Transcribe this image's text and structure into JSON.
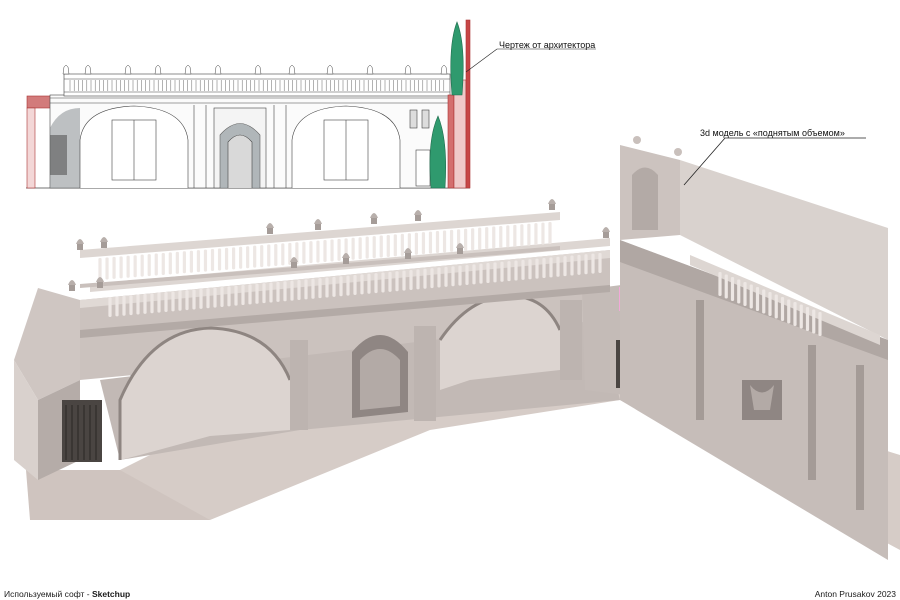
{
  "annotations": {
    "drawing_label": "Чертеж от архитектора",
    "model_label": "3d модель с «поднятым объемом»"
  },
  "footer": {
    "software_prefix": "Используемый софт - ",
    "software_name": "Sketchup",
    "author": "Anton Prusakov 2023"
  },
  "colors": {
    "background": "#ffffff",
    "model_base": "#c9c0bc",
    "model_light": "#ddd6d2",
    "model_shadow": "#8f8683",
    "ground": "#d4c9c4",
    "cast_shadow": "#3e4654",
    "window_pink": "#f2a9d8",
    "drawing_green": "#2f9a6e",
    "drawing_red": "#c94a4a",
    "drawing_line": "#444444"
  }
}
